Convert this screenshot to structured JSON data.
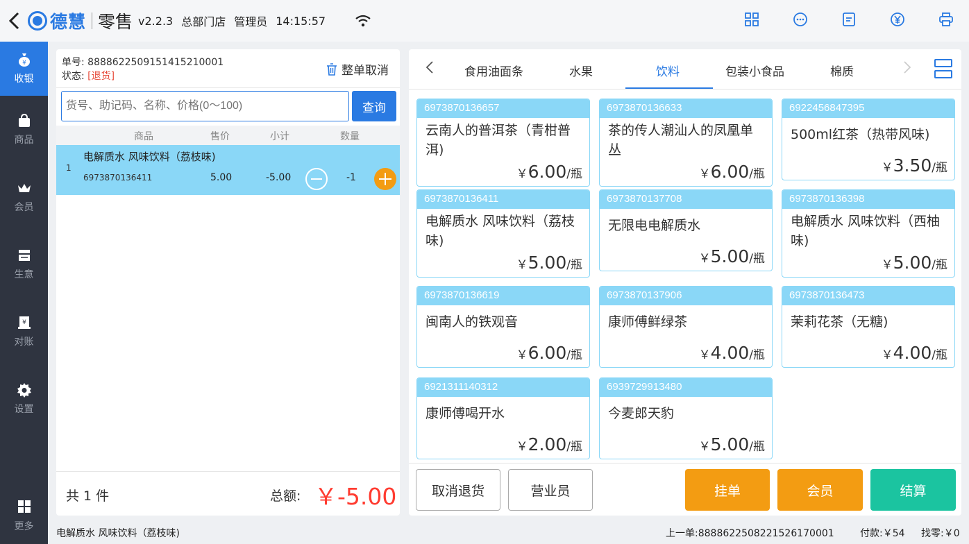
{
  "header": {
    "brand": "德慧",
    "app_name": "零售",
    "version": "v2.2.3",
    "store": "总部门店",
    "user": "管理员",
    "time": "14:15:57"
  },
  "sidebar": {
    "items": [
      {
        "label": "收银",
        "icon": "money-bag-icon"
      },
      {
        "label": "商品",
        "icon": "shopping-bag-icon"
      },
      {
        "label": "会员",
        "icon": "crown-icon"
      },
      {
        "label": "生意",
        "icon": "register-icon"
      },
      {
        "label": "对账",
        "icon": "ledger-icon"
      },
      {
        "label": "设置",
        "icon": "gear-icon"
      }
    ],
    "more": "更多"
  },
  "order": {
    "number_label": "单号:",
    "number": "8888622509151415210001",
    "status_label": "状态:",
    "status": "[退货]",
    "cancel_all": "整单取消",
    "search_placeholder": "货号、助记码、名称、价格(0～100)",
    "query_button": "查询",
    "columns": {
      "product": "商品",
      "price": "售价",
      "subtotal": "小计",
      "qty": "数量"
    },
    "rows": [
      {
        "index": "1",
        "name": "电解质水 风味饮料（荔枝味)",
        "code": "6973870136411",
        "price": "5.00",
        "subtotal": "-5.00",
        "qty": "-1"
      }
    ],
    "count_text": "共 1 件",
    "total_label": "总额:",
    "total": "￥-5.00"
  },
  "categories": {
    "tabs": [
      "食用油面条",
      "水果",
      "饮料",
      "包装小食品",
      "棉质"
    ],
    "active": "饮料"
  },
  "products": [
    {
      "barcode": "6973870136657",
      "name": "云南人的普洱茶（青柑普洱)",
      "currency": "￥",
      "price": "6.00",
      "unit": "/瓶"
    },
    {
      "barcode": "6973870136633",
      "name": "茶的传人潮汕人的凤凰单丛",
      "currency": "￥",
      "price": "6.00",
      "unit": "/瓶"
    },
    {
      "barcode": "6922456847395",
      "name": "500ml红茶（热带风味)",
      "currency": "￥",
      "price": "3.50",
      "unit": "/瓶"
    },
    {
      "barcode": "6973870136411",
      "name": "电解质水 风味饮料（荔枝味)",
      "currency": "￥",
      "price": "5.00",
      "unit": "/瓶"
    },
    {
      "barcode": "6973870137708",
      "name": "无限电电解质水",
      "currency": "￥",
      "price": "5.00",
      "unit": "/瓶"
    },
    {
      "barcode": "6973870136398",
      "name": "电解质水 风味饮料（西柚味)",
      "currency": "￥",
      "price": "5.00",
      "unit": "/瓶"
    },
    {
      "barcode": "6973870136619",
      "name": "闽南人的铁观音",
      "currency": "￥",
      "price": "6.00",
      "unit": "/瓶"
    },
    {
      "barcode": "6973870137906",
      "name": "康师傅鲜绿茶",
      "currency": "￥",
      "price": "4.00",
      "unit": "/瓶"
    },
    {
      "barcode": "6973870136473",
      "name": "茉莉花茶（无糖)",
      "currency": "￥",
      "price": "4.00",
      "unit": "/瓶"
    },
    {
      "barcode": "6921311140312",
      "name": "康师傅喝开水",
      "currency": "￥",
      "price": "2.00",
      "unit": "/瓶"
    },
    {
      "barcode": "6939729913480",
      "name": "今麦郎天豹",
      "currency": "￥",
      "price": "5.00",
      "unit": "/瓶"
    }
  ],
  "actions": {
    "cancel_return": "取消退货",
    "salesperson": "营业员",
    "hold": "挂单",
    "member": "会员",
    "checkout": "结算"
  },
  "statusbar": {
    "current_item": "电解质水 风味饮料（荔枝味)",
    "last_order": "上一单:8888622508221526170001",
    "paid": "付款:￥54",
    "change": "找零:￥0"
  },
  "colors": {
    "primary": "#2a7ae2",
    "sky": "#8ad7f7",
    "orange": "#f39c12",
    "teal": "#1bc4a0",
    "danger": "#ff3b30"
  }
}
